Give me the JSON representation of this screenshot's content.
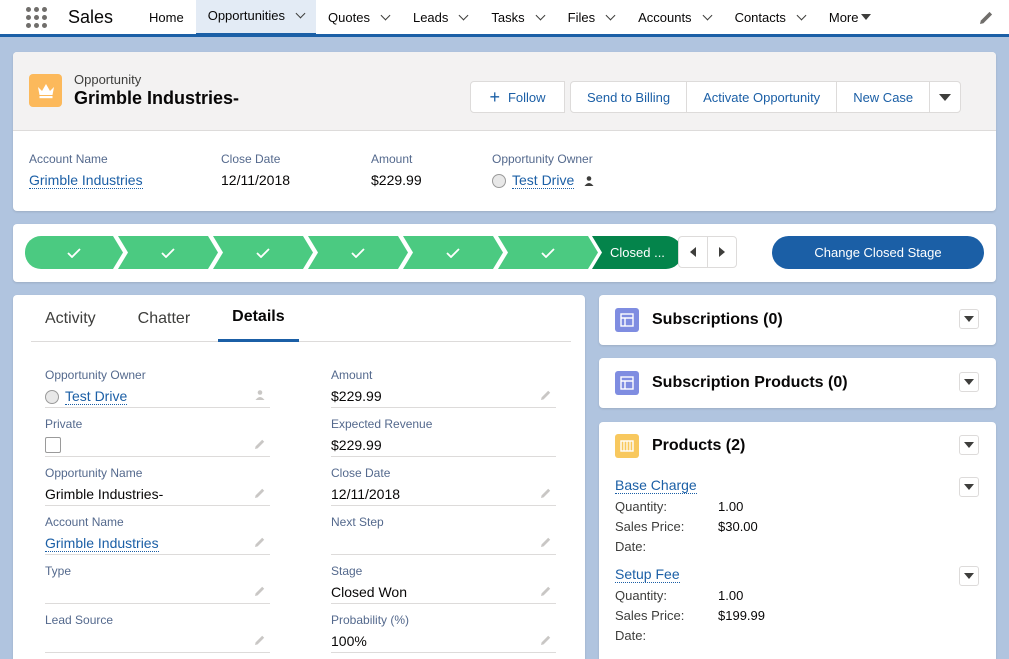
{
  "app": {
    "name": "Sales"
  },
  "nav": [
    {
      "label": "Home",
      "chevron": false
    },
    {
      "label": "Opportunities",
      "chevron": true,
      "active": true
    },
    {
      "label": "Quotes",
      "chevron": true
    },
    {
      "label": "Leads",
      "chevron": true
    },
    {
      "label": "Tasks",
      "chevron": true
    },
    {
      "label": "Files",
      "chevron": true
    },
    {
      "label": "Accounts",
      "chevron": true
    },
    {
      "label": "Contacts",
      "chevron": true
    },
    {
      "label": "More",
      "chevron": false
    }
  ],
  "record": {
    "type": "Opportunity",
    "name": "Grimble Industries-",
    "actions": {
      "follow": "Follow",
      "send_to_billing": "Send to Billing",
      "activate": "Activate Opportunity",
      "new_case": "New Case"
    },
    "highlights": {
      "account_label": "Account Name",
      "account_value": "Grimble Industries",
      "close_label": "Close Date",
      "close_value": "12/11/2018",
      "amount_label": "Amount",
      "amount_value": "$229.99",
      "owner_label": "Opportunity Owner",
      "owner_value": "Test Drive"
    }
  },
  "path": {
    "completed_steps": 6,
    "final_label": "Closed ...",
    "change_button": "Change Closed Stage"
  },
  "tabs": [
    "Activity",
    "Chatter",
    "Details"
  ],
  "active_tab": "Details",
  "details": {
    "left": [
      {
        "label": "Opportunity Owner",
        "value": "Test Drive"
      },
      {
        "label": "Private",
        "value": ""
      },
      {
        "label": "Opportunity Name",
        "value": "Grimble Industries-"
      },
      {
        "label": "Account Name",
        "value": "Grimble Industries"
      },
      {
        "label": "Type",
        "value": ""
      },
      {
        "label": "Lead Source",
        "value": ""
      }
    ],
    "right": [
      {
        "label": "Amount",
        "value": "$229.99"
      },
      {
        "label": "Expected Revenue",
        "value": "$229.99"
      },
      {
        "label": "Close Date",
        "value": "12/11/2018"
      },
      {
        "label": "Next Step",
        "value": ""
      },
      {
        "label": "Stage",
        "value": "Closed Won"
      },
      {
        "label": "Probability (%)",
        "value": "100%"
      }
    ]
  },
  "related": {
    "subscriptions": "Subscriptions (0)",
    "subscription_products": "Subscription Products (0)",
    "products": "Products (2)",
    "product_items": [
      {
        "name": "Base Charge",
        "qty_label": "Quantity:",
        "qty": "1.00",
        "price_label": "Sales Price:",
        "price": "$30.00",
        "date_label": "Date:"
      },
      {
        "name": "Setup Fee",
        "qty_label": "Quantity:",
        "qty": "1.00",
        "price_label": "Sales Price:",
        "price": "$199.99",
        "date_label": "Date:"
      }
    ]
  },
  "colors": {
    "brand": "#1b5fa6",
    "path_complete": "#4bca81",
    "path_final": "#04844b",
    "opportunity_icon": "#fcb95b",
    "subscription_icon": "#7f8de1",
    "products_icon": "#f8c85e"
  },
  "icons": {
    "app_launcher": "waffle-icon",
    "opportunity": "crown-icon",
    "edit": "pencil-icon",
    "subscription": "table-icon",
    "products": "product-icon"
  }
}
